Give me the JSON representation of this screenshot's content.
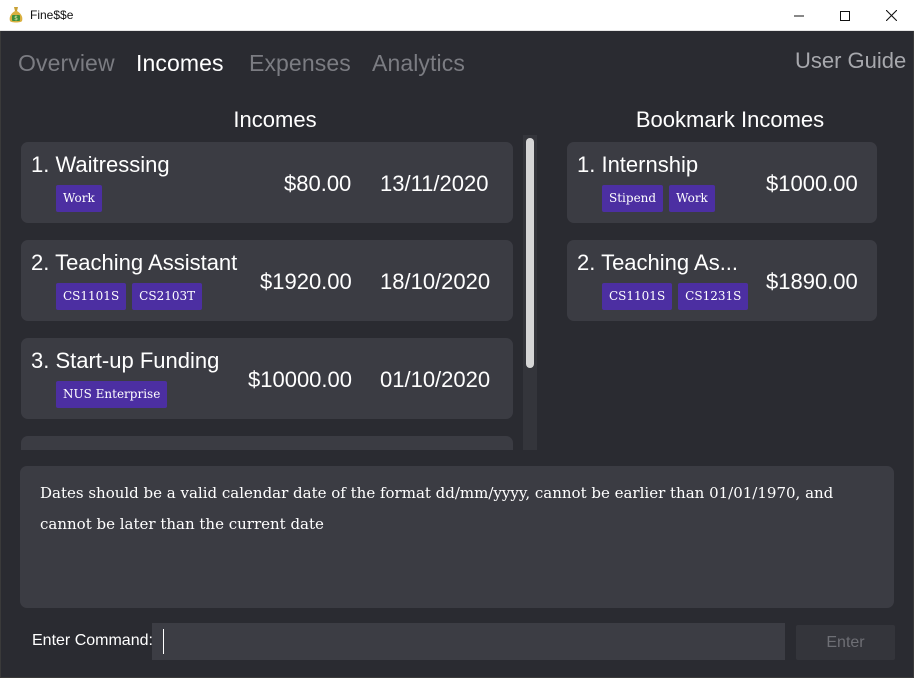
{
  "window": {
    "title": "Fine$$e",
    "minimize_glyph": "minimize-icon",
    "maximize_glyph": "maximize-icon",
    "close_glyph": "close-icon"
  },
  "tabs": [
    {
      "label": "Overview",
      "active": false
    },
    {
      "label": "Incomes",
      "active": true
    },
    {
      "label": "Expenses",
      "active": false
    },
    {
      "label": "Analytics",
      "active": false
    }
  ],
  "user_guide": "User Guide",
  "incomes_panel": {
    "title": "Incomes",
    "items": [
      {
        "title": "1. Waitressing",
        "amount": "$80.00",
        "date": "13/11/2020",
        "tags": [
          "Work"
        ]
      },
      {
        "title": "2. Teaching Assistant",
        "amount": "$1920.00",
        "date": "18/10/2020",
        "tags": [
          "CS1101S",
          "CS2103T"
        ]
      },
      {
        "title": "3. Start-up Funding",
        "amount": "$10000.00",
        "date": "01/10/2020",
        "tags": [
          "NUS Enterprise"
        ]
      }
    ]
  },
  "bookmark_panel": {
    "title": "Bookmark Incomes",
    "items": [
      {
        "title": "1. Internship",
        "amount": "$1000.00",
        "tags": [
          "Stipend",
          "Work"
        ]
      },
      {
        "title": "2. Teaching As...",
        "amount": "$1890.00",
        "tags": [
          "CS1101S",
          "CS1231S"
        ]
      }
    ]
  },
  "result_display": {
    "text": "Dates should be a valid calendar date of the format dd/mm/yyyy, cannot be earlier than 01/01/1970, and cannot be later than the current date"
  },
  "command_box": {
    "label": "Enter Command:",
    "value": "",
    "enter_label": "Enter"
  },
  "colors": {
    "background": "#2a2b31",
    "card": "#3b3c43",
    "tag": "#4c2fa2",
    "active_tab": "#ffffff",
    "inactive_tab": "#7b7c82"
  }
}
